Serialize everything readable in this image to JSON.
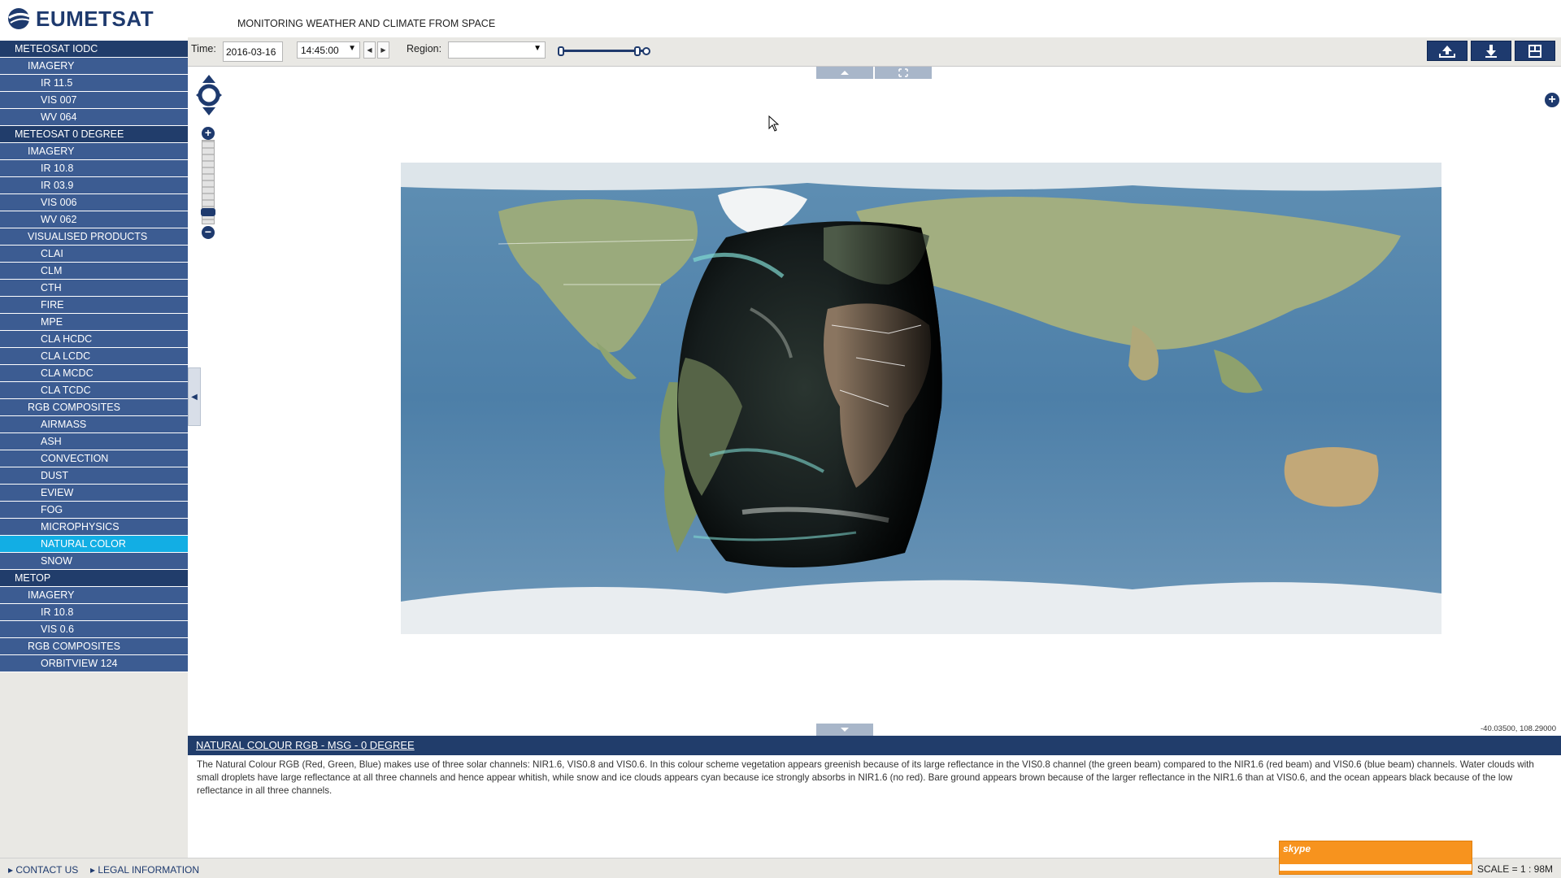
{
  "header": {
    "logo_text": "EUMETSAT",
    "tagline": "MONITORING WEATHER AND CLIMATE FROM SPACE"
  },
  "sidebar": {
    "items": [
      {
        "label": "METEOSAT IODC",
        "level": 0
      },
      {
        "label": "IMAGERY",
        "level": 1
      },
      {
        "label": "IR 11.5",
        "level": 2
      },
      {
        "label": "VIS 007",
        "level": 2
      },
      {
        "label": "WV 064",
        "level": 2
      },
      {
        "label": "METEOSAT 0 DEGREE",
        "level": 0
      },
      {
        "label": "IMAGERY",
        "level": 1
      },
      {
        "label": "IR 10.8",
        "level": 2
      },
      {
        "label": "IR 03.9",
        "level": 2
      },
      {
        "label": "VIS 006",
        "level": 2
      },
      {
        "label": "WV 062",
        "level": 2
      },
      {
        "label": "VISUALISED PRODUCTS",
        "level": 1
      },
      {
        "label": "CLAI",
        "level": 2
      },
      {
        "label": "CLM",
        "level": 2
      },
      {
        "label": "CTH",
        "level": 2
      },
      {
        "label": "FIRE",
        "level": 2
      },
      {
        "label": "MPE",
        "level": 2
      },
      {
        "label": "CLA HCDC",
        "level": 2
      },
      {
        "label": "CLA LCDC",
        "level": 2
      },
      {
        "label": "CLA MCDC",
        "level": 2
      },
      {
        "label": "CLA TCDC",
        "level": 2
      },
      {
        "label": "RGB COMPOSITES",
        "level": 1
      },
      {
        "label": "AIRMASS",
        "level": 2
      },
      {
        "label": "ASH",
        "level": 2
      },
      {
        "label": "CONVECTION",
        "level": 2
      },
      {
        "label": "DUST",
        "level": 2
      },
      {
        "label": "EVIEW",
        "level": 2
      },
      {
        "label": "FOG",
        "level": 2
      },
      {
        "label": "MICROPHYSICS",
        "level": 2
      },
      {
        "label": "NATURAL COLOR",
        "level": 2,
        "active": true
      },
      {
        "label": "SNOW",
        "level": 2
      },
      {
        "label": "METOP",
        "level": 0
      },
      {
        "label": "IMAGERY",
        "level": 1
      },
      {
        "label": "IR 10.8",
        "level": 2
      },
      {
        "label": "VIS 0.6",
        "level": 2
      },
      {
        "label": "RGB COMPOSITES",
        "level": 1
      },
      {
        "label": "ORBITVIEW 124",
        "level": 2
      }
    ]
  },
  "toolbar": {
    "time_label": "Time:",
    "date_value": "2016-03-16",
    "hour_value": "14:45:00",
    "region_label": "Region:",
    "region_value": "",
    "prev_icon": "triangle-left-icon",
    "next_icon": "triangle-right-icon",
    "buttons": [
      {
        "name": "upload-button",
        "icon": "upload-icon"
      },
      {
        "name": "download-button",
        "icon": "download-icon"
      },
      {
        "name": "layout-button",
        "icon": "layout-icon"
      }
    ]
  },
  "map": {
    "coords_readout": "-40.03500, 108.29000",
    "scale_readout": "SCALE = 1 : 98M"
  },
  "description": {
    "title": "NATURAL COLOUR RGB - MSG - 0 DEGREE",
    "body": "The Natural Colour RGB (Red, Green, Blue) makes use of three solar channels: NIR1.6, VIS0.8 and VIS0.6. In this colour scheme vegetation appears greenish because of its large reflectance in the VIS0.8 channel (the green beam) compared to the NIR1.6 (red beam) and VIS0.6 (blue beam) channels. Water clouds with small droplets have large reflectance at all three channels and hence appear whitish, while snow and ice clouds appears cyan because ice strongly absorbs in NIR1.6 (no red). Bare ground appears brown because of the larger reflectance in the NIR1.6 than at VIS0.6, and the ocean appears black because of the low reflectance in all three channels."
  },
  "footer": {
    "contact": "CONTACT US",
    "legal": "LEGAL INFORMATION",
    "skype_label": "skype"
  },
  "colors": {
    "navy": "#213d6b",
    "nav_blue": "#3c5c92",
    "active_cyan": "#12aee4",
    "skype_orange": "#f7931e"
  }
}
